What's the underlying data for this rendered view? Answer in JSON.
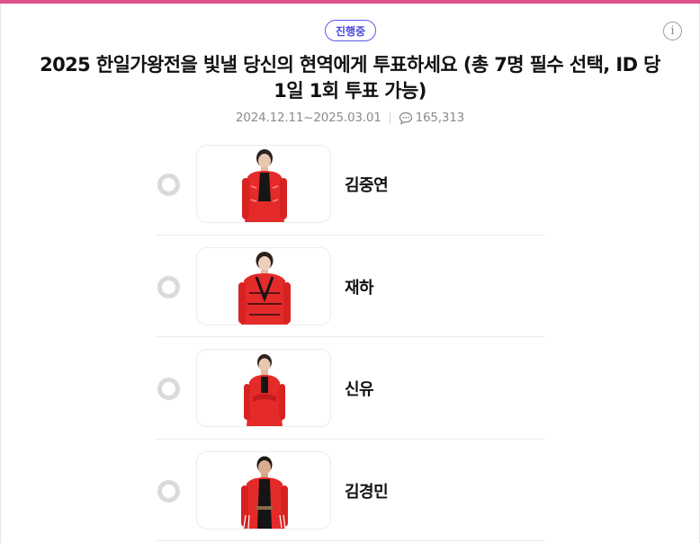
{
  "vote": {
    "status": "진행중",
    "title": "2025 한일가왕전을 빛낼 당신의 현역에게 투표하세요 (총 7명 필수 선택, ID 당 1일 1회 투표 가능)",
    "period": "2024.12.11~2025.03.01",
    "comment_count": "165,313",
    "info_icon": "info-icon",
    "comment_icon": "speech-bubble-icon"
  },
  "colors": {
    "accent_bar": "#e0508a",
    "badge": "#4b47e0",
    "costume_red": "#e52a2a"
  },
  "candidates": [
    {
      "name": "김중연"
    },
    {
      "name": "재하"
    },
    {
      "name": "신유"
    },
    {
      "name": "김경민"
    }
  ]
}
